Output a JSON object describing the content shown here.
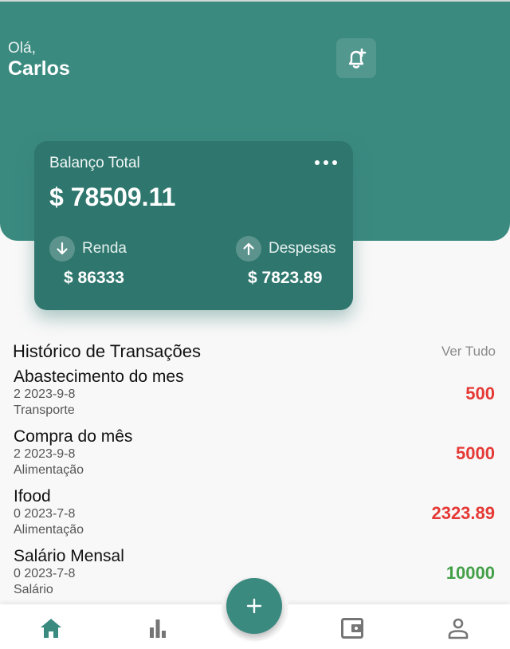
{
  "header": {
    "greeting": "Olá,",
    "user_name": "Carlos",
    "notification_icon": "bell-plus-icon"
  },
  "balance_card": {
    "title": "Balanço Total",
    "amount": "$ 78509.11",
    "more_icon": "more-horizontal-icon",
    "income": {
      "label": "Renda",
      "value": "$ 86333",
      "icon": "arrow-down-icon"
    },
    "expenses": {
      "label": "Despesas",
      "value": "$ 7823.89",
      "icon": "arrow-up-icon"
    }
  },
  "history": {
    "title": "Histórico de Transações",
    "see_all": "Ver Tudo",
    "items": [
      {
        "title": "Abastecimento do mes",
        "meta": "2  2023-9-8",
        "category": "Transporte",
        "amount": "500",
        "color": "#e53935"
      },
      {
        "title": "Compra do mês",
        "meta": "2  2023-9-8",
        "category": "Alimentação",
        "amount": "5000",
        "color": "#e53935"
      },
      {
        "title": "Ifood",
        "meta": "0  2023-7-8",
        "category": "Alimentação",
        "amount": "2323.89",
        "color": "#e53935"
      },
      {
        "title": "Salário Mensal",
        "meta": "0  2023-7-8",
        "category": "Salário",
        "amount": "10000",
        "color": "#43a047"
      }
    ]
  },
  "nav": {
    "items": [
      "home-icon",
      "bar-chart-icon",
      "wallet-icon",
      "profile-icon"
    ],
    "add_button_icon": "plus-icon"
  },
  "colors": {
    "primary": "#3b8a80",
    "card": "#2f776e",
    "expense": "#e53935",
    "income": "#43a047",
    "nav_active": "#3b8a80",
    "nav_inactive": "#757575"
  }
}
